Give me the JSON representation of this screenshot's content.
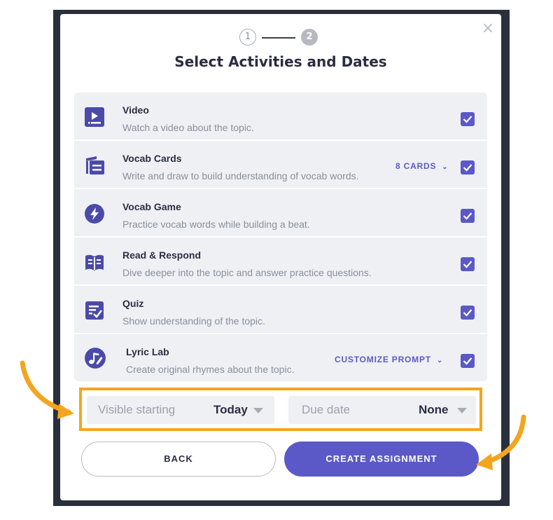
{
  "dialog": {
    "title": "Select Activities and Dates",
    "close_label": "×",
    "steps": [
      {
        "label": "1",
        "state": "completed"
      },
      {
        "label": "2",
        "state": "active"
      }
    ]
  },
  "activities": [
    {
      "name": "Video",
      "description": "Watch a video about the topic.",
      "icon": "video-icon",
      "checked": true
    },
    {
      "name": "Vocab Cards",
      "description": "Write and draw to build understanding of vocab words.",
      "icon": "vocab-cards-icon",
      "checked": true,
      "option": "8 CARDS"
    },
    {
      "name": "Vocab Game",
      "description": "Practice vocab words while building a beat.",
      "icon": "lightning-icon",
      "checked": true
    },
    {
      "name": "Read & Respond",
      "description": "Dive deeper into the topic and answer practice questions.",
      "icon": "book-icon",
      "checked": true
    },
    {
      "name": "Quiz",
      "description": "Show understanding of the topic.",
      "icon": "quiz-icon",
      "checked": true
    },
    {
      "name": "Lyric Lab",
      "description": "Create original rhymes about the topic.",
      "icon": "music-pen-icon",
      "checked": true,
      "option": "CUSTOMIZE PROMPT"
    }
  ],
  "dates": {
    "visible_label": "Visible starting",
    "visible_value": "Today",
    "due_label": "Due date",
    "due_value": "None"
  },
  "buttons": {
    "back": "BACK",
    "create": "CREATE ASSIGNMENT"
  },
  "colors": {
    "accent": "#5b59c7",
    "highlight": "#f4a51f",
    "row_bg": "#eef0f4"
  }
}
